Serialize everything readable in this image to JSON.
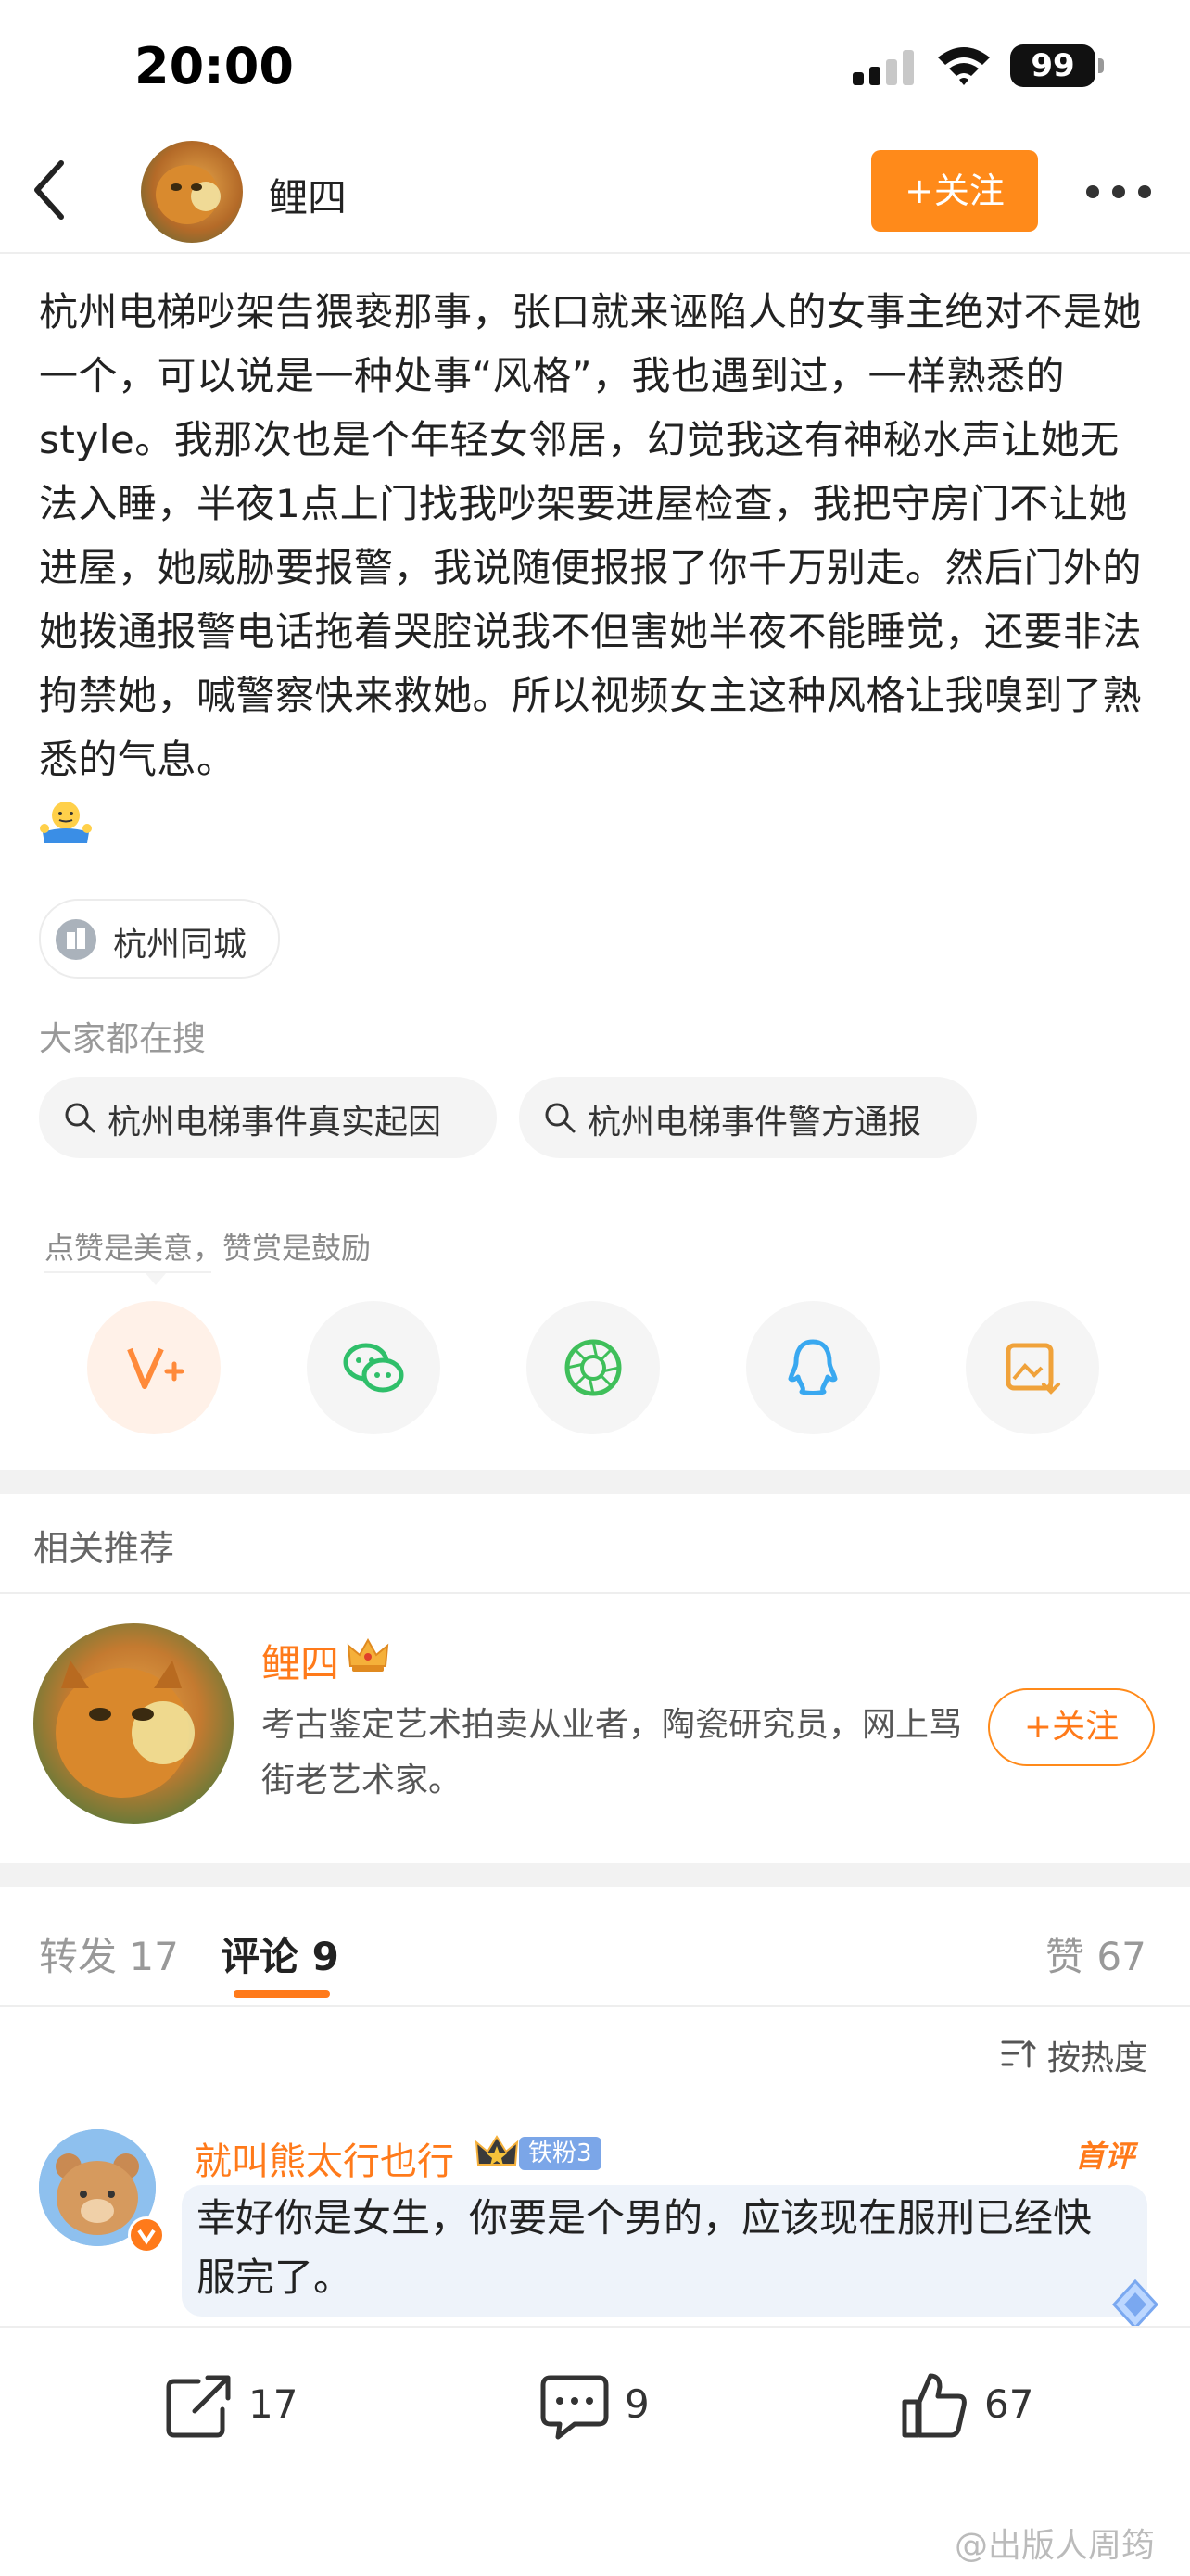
{
  "status_bar": {
    "time": "20:00",
    "battery": "99"
  },
  "header": {
    "name": "鲤四",
    "follow_label": "+关注"
  },
  "post": {
    "text": "杭州电梯吵架告猥亵那事，张口就来诬陷人的女事主绝对不是她一个，可以说是一种处事“风格”，我也遇到过，一样熟悉的style。我那次也是个年轻女邻居，幻觉我这有神秘水声让她无法入睡，半夜1点上门找我吵架要进屋检查，我把守房门不让她进屋，她威胁要报警，我说随便报报了你千万别走。然后门外的她拨通报警电话拖着哭腔说我不但害她半夜不能睡觉，还要非法拘禁她，喊警察快来救她。所以视频女主这种风格让我嗅到了熟悉的气息。",
    "topic": "杭州同城"
  },
  "search": {
    "title": "大家都在搜",
    "items": [
      "杭州电梯事件真实起因",
      "杭州电梯事件警方通报"
    ]
  },
  "share": {
    "hint": "点赞是美意，赞赏是鼓励",
    "icons": [
      "vplus-icon",
      "wechat-icon",
      "moments-icon",
      "qq-icon",
      "save-image-icon"
    ]
  },
  "related": {
    "title": "相关推荐",
    "name": "鲤四",
    "desc": "考古鉴定艺术拍卖从业者，陶瓷研究员，网上骂街老艺术家。",
    "follow_label": "+关注"
  },
  "tabs": {
    "repost": "转发 17",
    "comments": "评论 9",
    "likes": "赞 67"
  },
  "sort_label": "按热度",
  "comment": {
    "name": "就叫熊太行也行",
    "fan_badge": "铁粉3",
    "first_badge": "首评",
    "text": "幸好你是女生，你要是个男的，应该现在服刑已经快服完了。"
  },
  "bottom_bar": {
    "repost_count": "17",
    "comment_count": "9",
    "like_count": "67"
  },
  "watermark": "@出版人周筠",
  "colors": {
    "accent": "#ff7a1a",
    "follow_bg": "#ff8a1a",
    "fan_badge": "#7ba6e8"
  }
}
